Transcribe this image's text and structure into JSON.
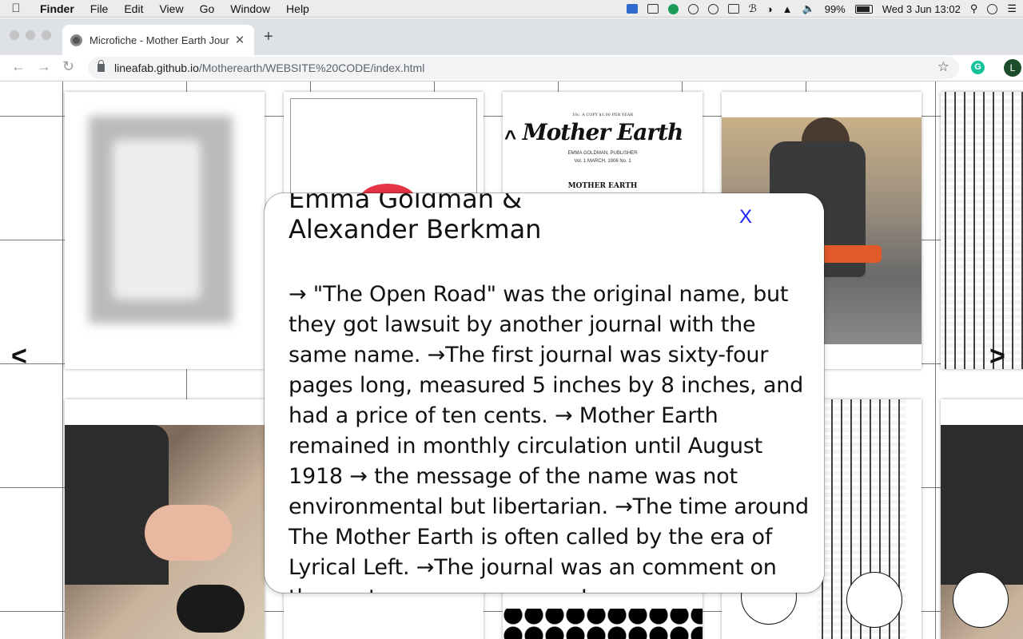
{
  "menubar": {
    "apple": "",
    "app": "Finder",
    "items": [
      "File",
      "Edit",
      "View",
      "Go",
      "Window",
      "Help"
    ],
    "battery": "99%",
    "clock": "Wed 3 Jun  13:02"
  },
  "browser": {
    "tab_title": "Microfiche - Mother Earth Jour",
    "tab_close": "✕",
    "new_tab": "+",
    "back": "←",
    "forward": "→",
    "reload": "↻",
    "url_host": "lineafab.github.io",
    "url_path": "/Motherearth/WEBSITE%20CODE/index.html",
    "star": "☆",
    "extension_letter": "G",
    "profile_letter": "L"
  },
  "page": {
    "cover": {
      "small": "10c. A COPY          $1.00 PER YEAR",
      "title": "Mother Earth",
      "publisher": "EMMA GOLDMAN, PUBLISHER",
      "date": "Vol. 1        MARCH, 1906        No. 1",
      "caption": "MOTHER EARTH"
    },
    "up_arrow": "^",
    "left_arrow": "<",
    "right_arrow": ">"
  },
  "modal": {
    "title_line1": "Emma Goldman &",
    "title_line2": "Alexander Berkman",
    "close": "X",
    "body": "→ \"The Open Road\" was the original name, but they got lawsuit by another journal with the same name. →The first journal was sixty-four pages long, measured 5 inches by 8 inches, and had a price of ten cents. → Mother Earth remained in monthly circulation until August 1918 → the message of the name was not environmental but libertarian. →The time around The Mother Earth is often called by the era of Lyrical Left. →The journal was an comment on the contemporary scene → In"
  }
}
